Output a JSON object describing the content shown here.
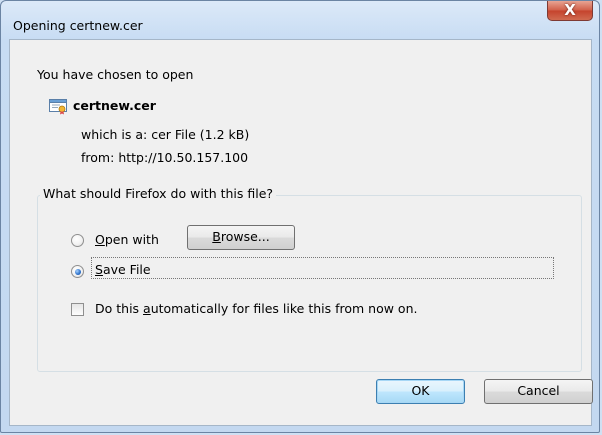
{
  "window": {
    "title": "Opening certnew.cer",
    "close_glyph": "X"
  },
  "dialog": {
    "chosen_label": "You have chosen to open",
    "file_name": "certnew.cer",
    "which_label": "which is a:",
    "which_value": "cer File (1.2  kB)",
    "from_label": "from:",
    "from_value": "http://10.50.157.100"
  },
  "action_group": {
    "legend": "What should Firefox do with this file?",
    "open_with": {
      "prefix": "",
      "mnemonic": "O",
      "rest": "pen with",
      "checked": false
    },
    "browse_button": {
      "mnemonic": "B",
      "rest": "rowse..."
    },
    "save_file": {
      "mnemonic": "S",
      "rest": "ave File",
      "checked": true
    },
    "auto": {
      "prefix": "Do this ",
      "mnemonic": "a",
      "rest": "utomatically for files like this from now on.",
      "checked": false
    }
  },
  "buttons": {
    "ok": "OK",
    "cancel": "Cancel"
  },
  "icons": {
    "file": "certificate-file-icon",
    "close": "close-icon"
  }
}
